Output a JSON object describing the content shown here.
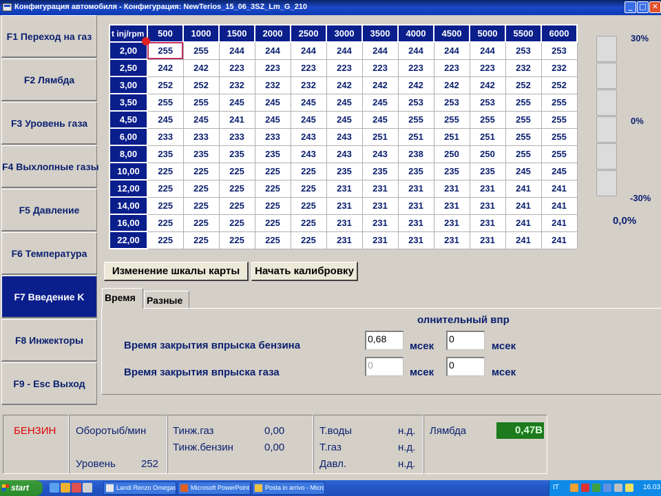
{
  "window": {
    "title": "Конфигурация автомобиля - Конфигурация: NewTerios_15_06_3SZ_Lm_G_210",
    "minimize": "_",
    "maximize": "□",
    "close": "✕"
  },
  "sidebar": {
    "items": [
      {
        "label": "F1 Переход на газ"
      },
      {
        "label": "F2 Лямбда"
      },
      {
        "label": "F3 Уровень газа"
      },
      {
        "label": "F4 Выхлопные газы"
      },
      {
        "label": "F5 Давление"
      },
      {
        "label": "F6 Температура"
      },
      {
        "label": "F7 Введение K",
        "active": true
      },
      {
        "label": "F8 Инжекторы"
      },
      {
        "label": "F9 - Esc Выход"
      }
    ]
  },
  "map": {
    "corner": "t inj/rpm",
    "columns": [
      "500",
      "1000",
      "1500",
      "2000",
      "2500",
      "3000",
      "3500",
      "4000",
      "4500",
      "5000",
      "5500",
      "6000"
    ],
    "rows": [
      {
        "label": "2,00",
        "values": [
          "255",
          "255",
          "244",
          "244",
          "244",
          "244",
          "244",
          "244",
          "244",
          "244",
          "253",
          "253"
        ]
      },
      {
        "label": "2,50",
        "values": [
          "242",
          "242",
          "223",
          "223",
          "223",
          "223",
          "223",
          "223",
          "223",
          "223",
          "232",
          "232"
        ]
      },
      {
        "label": "3,00",
        "values": [
          "252",
          "252",
          "232",
          "232",
          "232",
          "242",
          "242",
          "242",
          "242",
          "242",
          "252",
          "252"
        ]
      },
      {
        "label": "3,50",
        "values": [
          "255",
          "255",
          "245",
          "245",
          "245",
          "245",
          "245",
          "253",
          "253",
          "253",
          "255",
          "255"
        ]
      },
      {
        "label": "4,50",
        "values": [
          "245",
          "245",
          "241",
          "245",
          "245",
          "245",
          "245",
          "255",
          "255",
          "255",
          "255",
          "255"
        ]
      },
      {
        "label": "6,00",
        "values": [
          "233",
          "233",
          "233",
          "233",
          "243",
          "243",
          "251",
          "251",
          "251",
          "251",
          "255",
          "255"
        ]
      },
      {
        "label": "8,00",
        "values": [
          "235",
          "235",
          "235",
          "235",
          "243",
          "243",
          "243",
          "238",
          "250",
          "250",
          "255",
          "255"
        ]
      },
      {
        "label": "10,00",
        "values": [
          "225",
          "225",
          "225",
          "225",
          "225",
          "235",
          "235",
          "235",
          "235",
          "235",
          "245",
          "245"
        ]
      },
      {
        "label": "12,00",
        "values": [
          "225",
          "225",
          "225",
          "225",
          "225",
          "231",
          "231",
          "231",
          "231",
          "231",
          "241",
          "241"
        ]
      },
      {
        "label": "14,00",
        "values": [
          "225",
          "225",
          "225",
          "225",
          "225",
          "231",
          "231",
          "231",
          "231",
          "231",
          "241",
          "241"
        ]
      },
      {
        "label": "16,00",
        "values": [
          "225",
          "225",
          "225",
          "225",
          "225",
          "231",
          "231",
          "231",
          "231",
          "231",
          "241",
          "241"
        ]
      },
      {
        "label": "22,00",
        "values": [
          "225",
          "225",
          "225",
          "225",
          "225",
          "231",
          "231",
          "231",
          "231",
          "231",
          "241",
          "241"
        ]
      }
    ]
  },
  "gauge": {
    "top_label": "30%",
    "mid_label": "0%",
    "bottom_label": "-30%",
    "value": "0,0%",
    "segments": 6
  },
  "buttons": {
    "scale": "Изменение шкалы карты",
    "calibrate": "Начать калибровку"
  },
  "tabs": {
    "time": "Время",
    "misc": "Разные"
  },
  "panel": {
    "header": "олнительный впр",
    "petrol_label": "Время закрытия впрыска бензина",
    "gas_label": "Время закрытия впрыска газа",
    "petrol_value1": "0,68",
    "petrol_value2": "0",
    "gas_value1": "0",
    "gas_value2": "0",
    "unit": "мсек"
  },
  "status": {
    "fuel": "БЕНЗИН",
    "rpm_label": "Оборотыб/мин",
    "level_label": "Уровень",
    "level_value": "252",
    "tinj_gas_label": "Тинж.газ",
    "tinj_gas_value": "0,00",
    "tinj_petrol_label": "Тинж.бензин",
    "tinj_petrol_value": "0,00",
    "t_water_label": "Т.воды",
    "t_water_value": "н.д.",
    "t_gas_label": "Т.газ",
    "t_gas_value": "н.д.",
    "pressure_label": "Давл.",
    "pressure_value": "н.д.",
    "lambda_label": "Лямбда",
    "lambda_value": "0,47В"
  },
  "taskbar": {
    "start": "start",
    "tasks": [
      "Landi Renzo Omegas",
      "Microsoft PowerPoint ...",
      "Posta in arrivo - Micro..."
    ],
    "lang": "IT",
    "clock": "16.03"
  },
  "colors": {
    "accent": "#0a1e8c",
    "text": "#0a1e6e",
    "fuel": "#e00000",
    "lambda": "#1d7a1d"
  }
}
